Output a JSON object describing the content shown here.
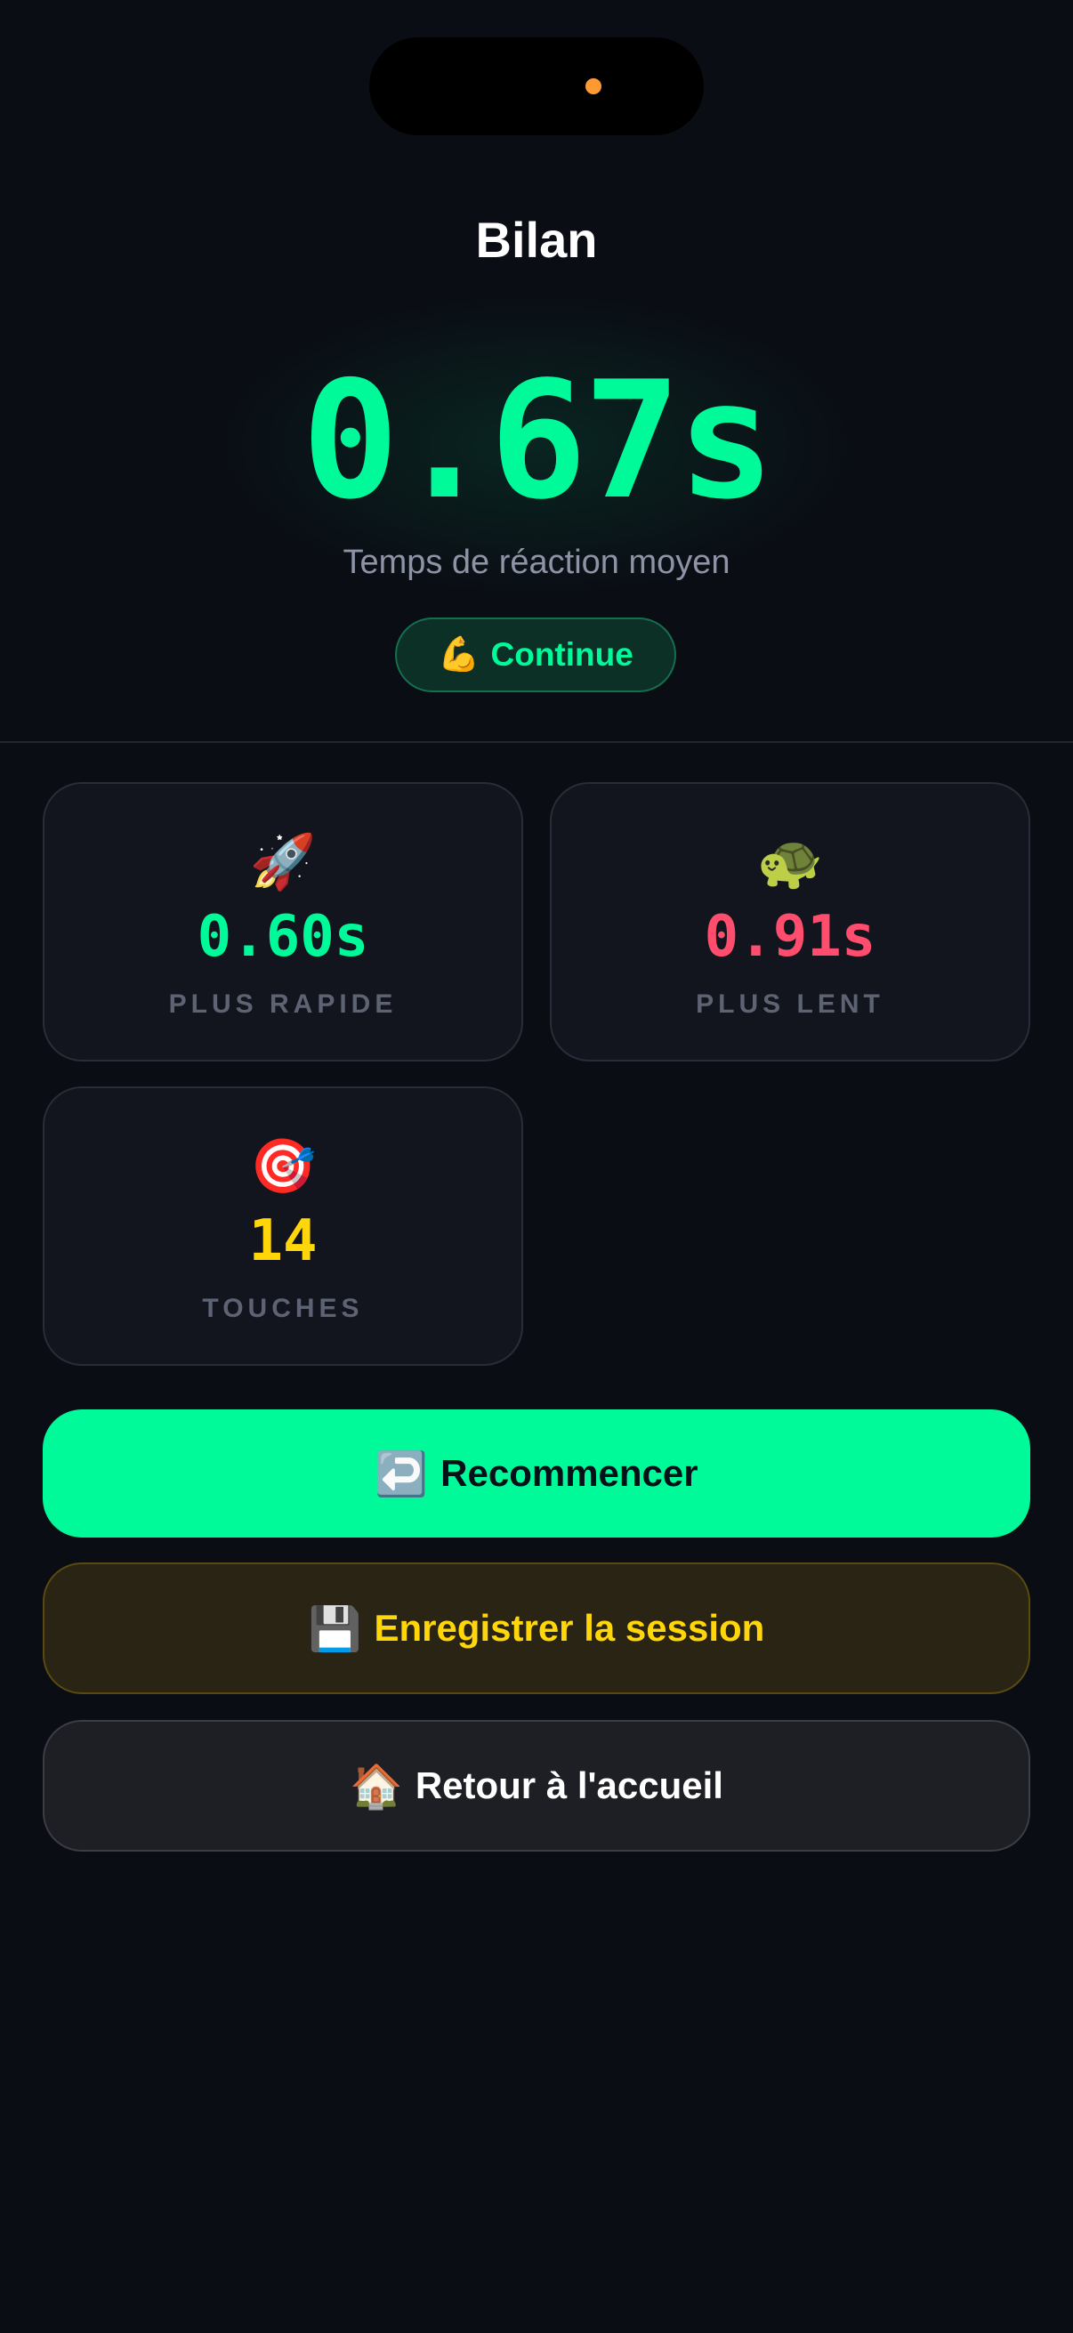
{
  "colors": {
    "accent_green": "#00FA9A",
    "slow_red": "#FF4D6D",
    "taps_yellow": "#FFD60A",
    "island_dot": "#FF9933"
  },
  "header": {
    "title": "Bilan"
  },
  "summary": {
    "average_time": "0.67s",
    "average_label": "Temps de réaction moyen",
    "rating_icon": "💪",
    "rating_label": "Continue"
  },
  "stats": [
    {
      "icon": "🚀",
      "icon_name": "rocket-icon",
      "value": "0.60s",
      "label": "PLUS RAPIDE"
    },
    {
      "icon": "🐢",
      "icon_name": "turtle-icon",
      "value": "0.91s",
      "label": "PLUS LENT"
    },
    {
      "icon": "🎯",
      "icon_name": "target-icon",
      "value": "14",
      "label": "TOUCHES"
    }
  ],
  "actions": {
    "restart": {
      "icon": "↩️",
      "label": "Recommencer"
    },
    "save": {
      "icon": "💾",
      "label": "Enregistrer la session"
    },
    "home": {
      "icon": "🏠",
      "label": "Retour à l'accueil"
    }
  }
}
